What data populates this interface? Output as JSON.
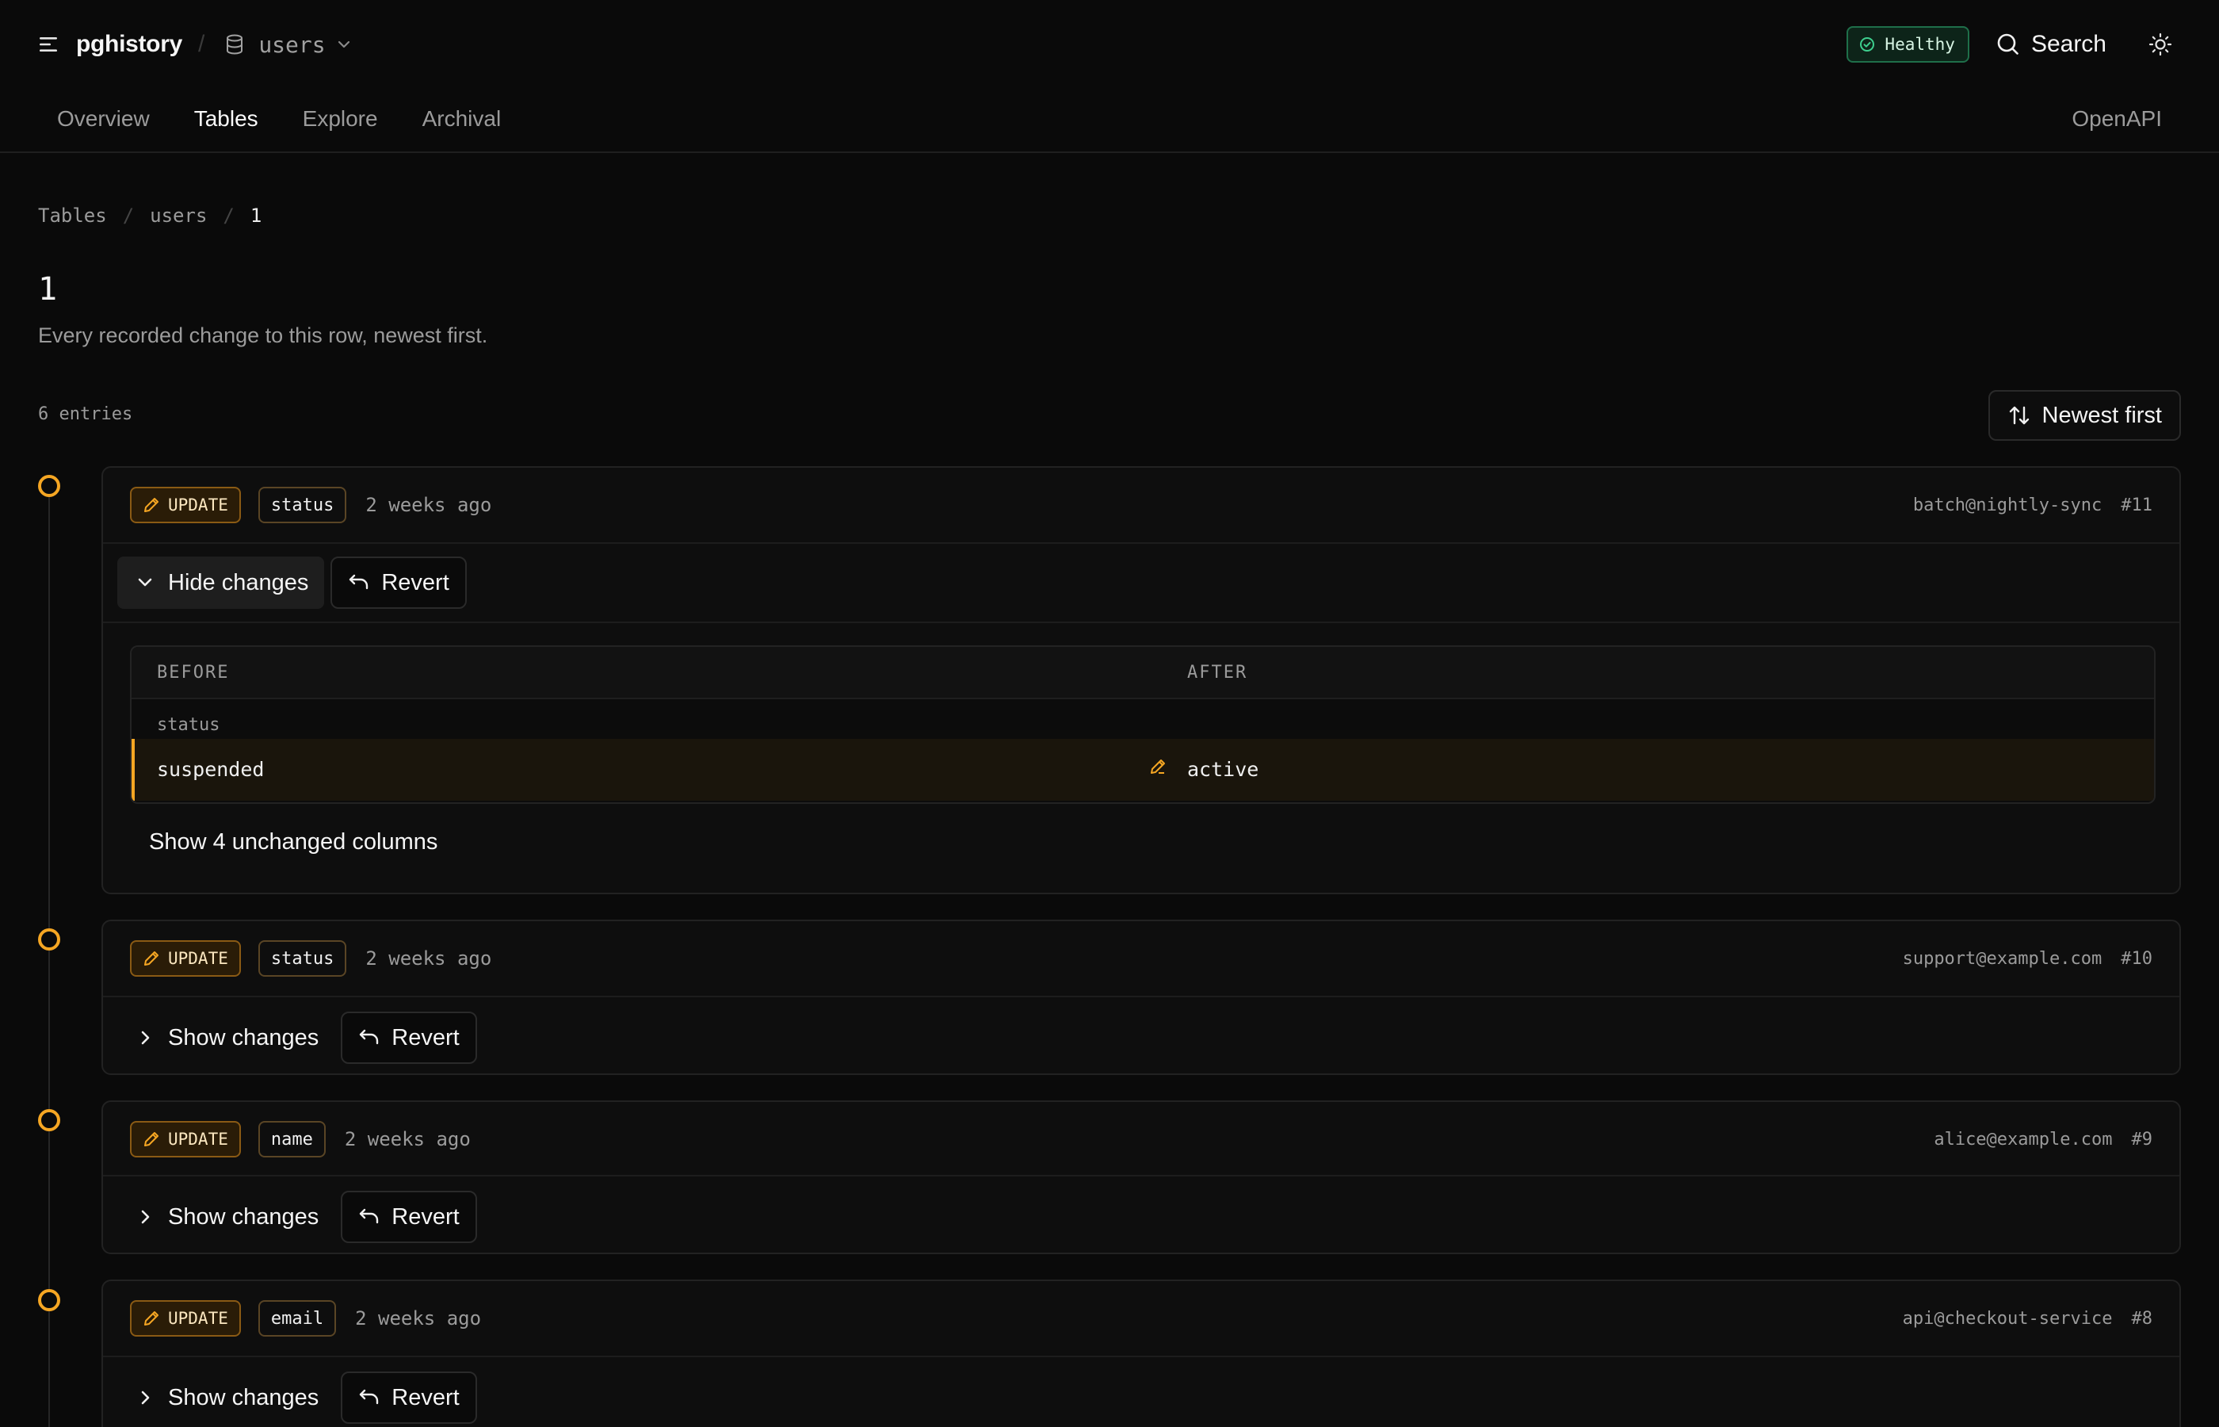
{
  "app": {
    "name": "pghistory",
    "database": "users"
  },
  "header": {
    "status": "Healthy",
    "search_label": "Search"
  },
  "nav": {
    "tabs": [
      {
        "label": "Overview",
        "active": false
      },
      {
        "label": "Tables",
        "active": true
      },
      {
        "label": "Explore",
        "active": false
      },
      {
        "label": "Archival",
        "active": false
      }
    ],
    "openapi": "OpenAPI"
  },
  "breadcrumb": [
    "Tables",
    "users",
    "1"
  ],
  "page": {
    "title": "1",
    "subtitle": "Every recorded change to this row, newest first.",
    "entries": "6 entries",
    "sort_label": "Newest first"
  },
  "entries": [
    {
      "op": "UPDATE",
      "column": "status",
      "ago": "2 weeks ago",
      "actor": "batch@nightly-sync",
      "id": "#11",
      "toggle": "Hide changes",
      "revert": "Revert",
      "diff": {
        "before_header": "BEFORE",
        "after_header": "AFTER",
        "column": "status",
        "before": "suspended",
        "after": "active"
      },
      "unchanged": "Show 4 unchanged columns"
    },
    {
      "op": "UPDATE",
      "column": "status",
      "ago": "2 weeks ago",
      "actor": "support@example.com",
      "id": "#10",
      "toggle": "Show changes",
      "revert": "Revert"
    },
    {
      "op": "UPDATE",
      "column": "name",
      "ago": "2 weeks ago",
      "actor": "alice@example.com",
      "id": "#9",
      "toggle": "Show changes",
      "revert": "Revert"
    },
    {
      "op": "UPDATE",
      "column": "email",
      "ago": "2 weeks ago",
      "actor": "api@checkout-service",
      "id": "#8",
      "toggle": "Show changes",
      "revert": "Revert"
    }
  ],
  "colors": {
    "background": "#0a0a0a",
    "accent": "#f5a623",
    "healthy": "#1f6f4a"
  },
  "icons": [
    "menu-icon",
    "database-icon",
    "chevron-down-icon",
    "check-circle-icon",
    "search-icon",
    "sun-icon",
    "sort-icon",
    "pencil-icon",
    "chevron-right-icon",
    "undo-icon"
  ]
}
